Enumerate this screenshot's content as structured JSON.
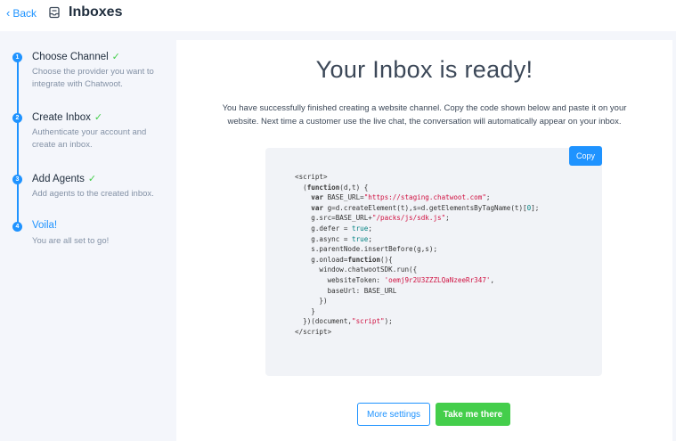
{
  "header": {
    "back_label": "Back",
    "title": "Inboxes"
  },
  "steps": [
    {
      "number": "1",
      "title": "Choose Channel",
      "description": "Choose the provider you want to integrate with Chatwoot.",
      "completed": true
    },
    {
      "number": "2",
      "title": "Create Inbox",
      "description": "Authenticate your account and create an inbox.",
      "completed": true
    },
    {
      "number": "3",
      "title": "Add Agents",
      "description": "Add agents to the created inbox.",
      "completed": true
    },
    {
      "number": "4",
      "title": "Voila!",
      "description": "You are all set to go!",
      "completed": false
    }
  ],
  "main": {
    "heading": "Your Inbox is ready!",
    "description": "You have successfully finished creating a website channel. Copy the code shown below and paste it on your website. Next time a customer use the live chat, the conversation will automatically appear on your inbox.",
    "copy_label": "Copy",
    "more_settings_label": "More settings",
    "take_me_there_label": "Take me there"
  },
  "colors": {
    "accent": "#1f93ff",
    "success": "#44ce4b",
    "muted": "#8492a6"
  },
  "icons": {
    "back": "chevron-left-icon",
    "inbox": "inbox-icon",
    "check": "check-icon"
  }
}
